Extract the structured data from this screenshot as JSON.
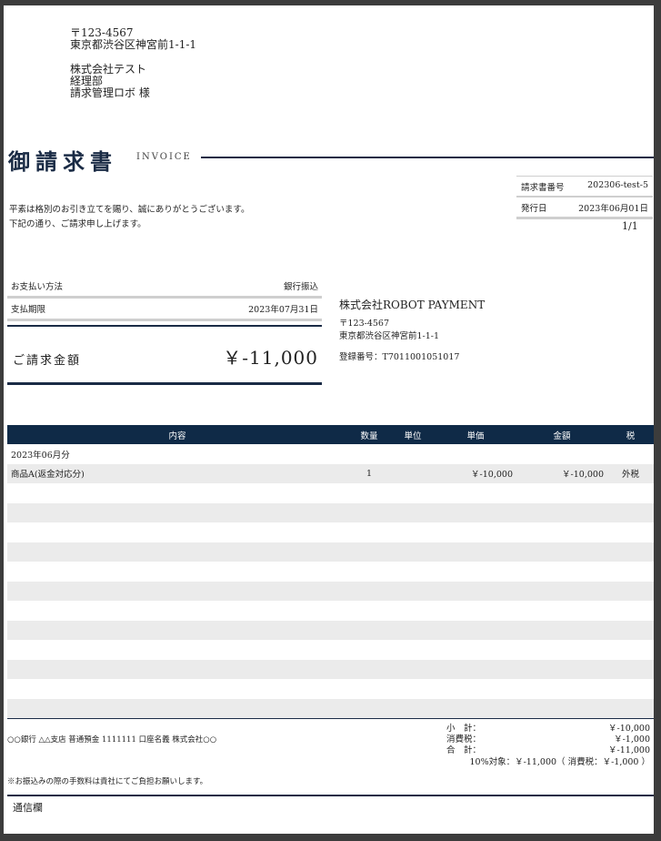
{
  "recipient": {
    "zip": "〒123-4567",
    "address": "東京都渋谷区神宮前1-1-1",
    "company": "株式会社テスト",
    "department": "経理部",
    "person": "請求管理ロボ 様"
  },
  "header": {
    "title": "御請求書",
    "subtitle": "INVOICE"
  },
  "meta": {
    "invoice_no_label": "請求書番号",
    "invoice_no": "202306-test-5",
    "issue_date_label": "発行日",
    "issue_date": "2023年06月01日",
    "page": "1/1"
  },
  "greeting": {
    "line1": "平素は格別のお引き立てを賜り、誠にありがとうございます。",
    "line2": "下記の通り、ご請求申し上げます。"
  },
  "payment": {
    "method_label": "お支払い方法",
    "method": "銀行振込",
    "due_label": "支払期限",
    "due": "2023年07月31日",
    "total_label": "ご請求金額",
    "total": "￥-11,000"
  },
  "issuer": {
    "company": "株式会社ROBOT PAYMENT",
    "zip": "〒123-4567",
    "address": "東京都渋谷区神宮前1-1-1",
    "registration": "登録番号：T7011001051017"
  },
  "table": {
    "headers": {
      "content": "内容",
      "qty": "数量",
      "unit": "単位",
      "price": "単価",
      "amount": "金額",
      "tax": "税"
    },
    "rows": [
      {
        "content": "2023年06月分",
        "qty": "",
        "unit": "",
        "price": "",
        "amount": "",
        "tax": ""
      },
      {
        "content": "商品A(返金対応分)",
        "qty": "1",
        "unit": "",
        "price": "￥-10,000",
        "amount": "￥-10,000",
        "tax": "外税"
      }
    ]
  },
  "bank": "○○銀行 △△支店 普通預金 1111111 口座名義 株式会社○○",
  "note": "※お振込みの際の手数料は貴社にてご負担お願いします。",
  "summary": {
    "subtotal_label": "小　計：",
    "subtotal": "￥-10,000",
    "tax_label": "消費税：",
    "tax": "￥-1,000",
    "total_label": "合　計：",
    "total": "￥-11,000",
    "tax_breakdown": "10%対象：￥-11,000（ 消費税：￥-1,000 ）"
  },
  "communication_label": "通信欄"
}
